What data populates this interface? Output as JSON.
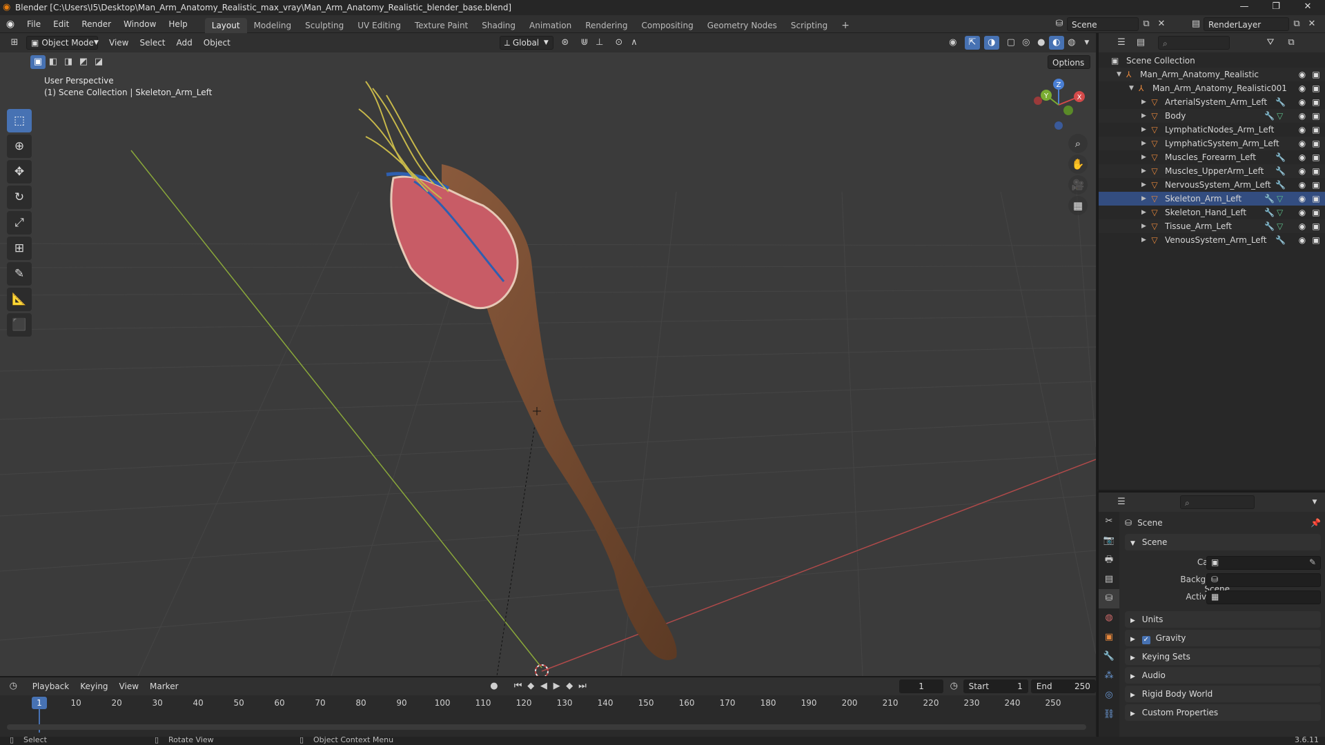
{
  "window": {
    "title": "Blender [C:\\Users\\I5\\Desktop\\Man_Arm_Anatomy_Realistic_max_vray\\Man_Arm_Anatomy_Realistic_blender_base.blend]"
  },
  "menus": [
    "File",
    "Edit",
    "Render",
    "Window",
    "Help"
  ],
  "workspaces": [
    {
      "label": "Layout",
      "active": true
    },
    {
      "label": "Modeling"
    },
    {
      "label": "Sculpting"
    },
    {
      "label": "UV Editing"
    },
    {
      "label": "Texture Paint"
    },
    {
      "label": "Shading"
    },
    {
      "label": "Animation"
    },
    {
      "label": "Rendering"
    },
    {
      "label": "Compositing"
    },
    {
      "label": "Geometry Nodes"
    },
    {
      "label": "Scripting"
    }
  ],
  "top_right": {
    "scene": "Scene",
    "view_layer": "RenderLayer"
  },
  "viewport": {
    "mode": "Object Mode",
    "menus": [
      "View",
      "Select",
      "Add",
      "Object"
    ],
    "transform_orientation": "Global",
    "options_label": "Options",
    "overlay_line1": "User Perspective",
    "overlay_line2": "(1) Scene Collection | Skeleton_Arm_Left"
  },
  "gizmo": {
    "x": "X",
    "y": "Y",
    "z": "Z"
  },
  "outliner": {
    "root": "Scene Collection",
    "collection": "Man_Arm_Anatomy_Realistic",
    "sub_collection": "Man_Arm_Anatomy_Realistic001",
    "objects": [
      {
        "name": "ArterialSystem_Arm_Left"
      },
      {
        "name": "Body"
      },
      {
        "name": "LymphaticNodes_Arm_Left"
      },
      {
        "name": "LymphaticSystem_Arm_Left"
      },
      {
        "name": "Muscles_Forearm_Left"
      },
      {
        "name": "Muscles_UpperArm_Left"
      },
      {
        "name": "NervousSystem_Arm_Left"
      },
      {
        "name": "Skeleton_Arm_Left"
      },
      {
        "name": "Skeleton_Hand_Left"
      },
      {
        "name": "Tissue_Arm_Left"
      },
      {
        "name": "VenousSystem_Arm_Left"
      }
    ]
  },
  "properties": {
    "context": "Scene",
    "panel": "Scene",
    "camera_label": "Camera",
    "bg_scene_label": "Background Scene",
    "active_clip_label": "Active Clip",
    "sections": [
      "Units",
      "Gravity",
      "Keying Sets",
      "Audio",
      "Rigid Body World",
      "Custom Properties"
    ]
  },
  "timeline": {
    "menus": [
      "Playback",
      "Keying",
      "View",
      "Marker"
    ],
    "current_frame": "1",
    "start_label": "Start",
    "start": "1",
    "end_label": "End",
    "end": "250",
    "ticks": [
      "1",
      "10",
      "20",
      "30",
      "40",
      "50",
      "60",
      "70",
      "80",
      "90",
      "100",
      "110",
      "120",
      "130",
      "140",
      "150",
      "160",
      "170",
      "180",
      "190",
      "200",
      "210",
      "220",
      "230",
      "240",
      "250"
    ]
  },
  "status": {
    "select": "Select",
    "rotate": "Rotate View",
    "context_menu": "Object Context Menu",
    "version": "3.6.11"
  }
}
